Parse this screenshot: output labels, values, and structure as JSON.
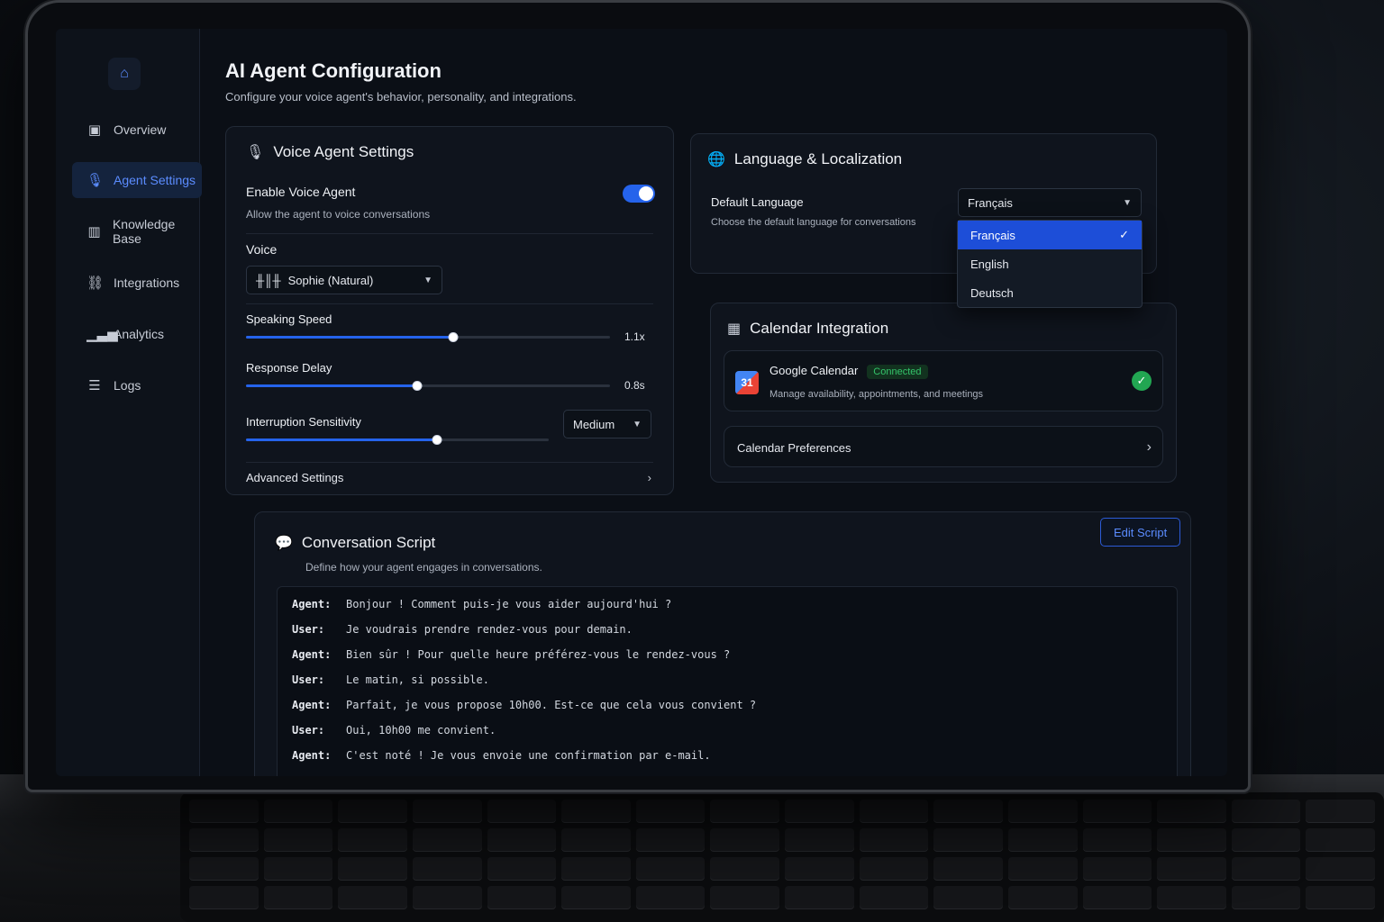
{
  "page": {
    "title": "AI Agent Configuration",
    "subtitle": "Configure your voice agent's behavior, personality, and integrations."
  },
  "sidebar": {
    "logo_icon": "home-icon",
    "items": [
      {
        "label": "Overview",
        "icon": "overview-icon",
        "active": false
      },
      {
        "label": "Agent Settings",
        "icon": "microphone-icon",
        "active": true
      },
      {
        "label": "Knowledge Base",
        "icon": "book-icon",
        "active": false
      },
      {
        "label": "Integrations",
        "icon": "link-icon",
        "active": false
      },
      {
        "label": "Analytics",
        "icon": "bar-chart-icon",
        "active": false
      },
      {
        "label": "Logs",
        "icon": "list-icon",
        "active": false
      }
    ]
  },
  "voice_settings": {
    "title": "Voice Agent Settings",
    "enable_label": "Enable Voice Agent",
    "enable_sub": "Allow the agent to voice conversations",
    "enabled": true,
    "voice_label": "Voice",
    "voice_value": "Sophie (Natural)",
    "speaking_speed_label": "Speaking Speed",
    "speaking_speed_value": "1.1x",
    "speaking_speed_level": 0.57,
    "response_delay_label": "Response Delay",
    "response_delay_value": "0.8s",
    "response_delay_level": 0.47,
    "interruption_label": "Interruption Sensitivity",
    "interruption_value": "Medium",
    "interruption_level": 0.63,
    "advanced_label": "Advanced Settings"
  },
  "language": {
    "title": "Language & Localization",
    "default_label": "Default Language",
    "default_sub": "Choose the default language for conversations",
    "selected": "Français",
    "options": [
      "Français",
      "English",
      "Deutsch"
    ]
  },
  "calendar": {
    "title": "Calendar Integration",
    "provider": "Google Calendar",
    "status": "Connected",
    "description": "Manage availability, appointments, and meetings",
    "preferences_label": "Calendar Preferences"
  },
  "script": {
    "title": "Conversation Script",
    "subtitle": "Define how your agent engages in conversations.",
    "edit_label": "Edit Script",
    "lines": [
      {
        "speaker": "Agent:",
        "text": "Bonjour ! Comment puis-je vous aider aujourd'hui ?"
      },
      {
        "speaker": "User:",
        "text": "Je voudrais prendre rendez-vous pour demain."
      },
      {
        "speaker": "Agent:",
        "text": "Bien sûr ! Pour quelle heure préférez-vous le rendez-vous ?"
      },
      {
        "speaker": "User:",
        "text": "Le matin, si possible."
      },
      {
        "speaker": "Agent:",
        "text": "Parfait, je vous propose 10h00. Est-ce que cela vous convient ?"
      },
      {
        "speaker": "User:",
        "text": "Oui, 10h00 me convient."
      },
      {
        "speaker": "Agent:",
        "text": "C'est noté ! Je vous envoie une confirmation par e-mail."
      }
    ]
  },
  "colors": {
    "accent": "#2563eb",
    "success": "#22a652",
    "background": "#0b0f16"
  }
}
